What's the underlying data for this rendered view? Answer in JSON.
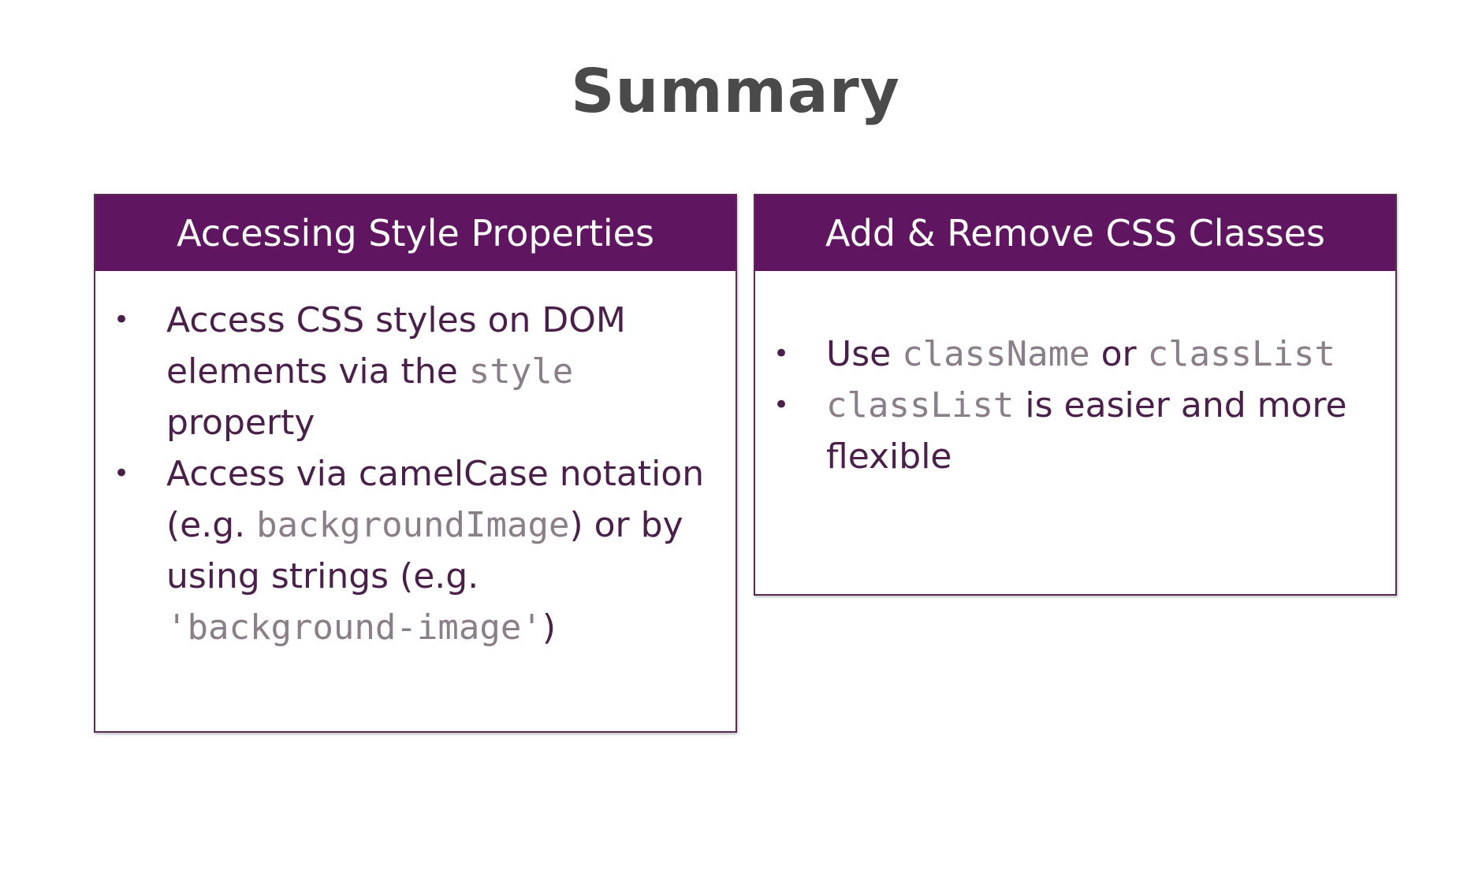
{
  "title": "Summary",
  "colors": {
    "header_bg": "#5f155f",
    "title": "#4a4a4a",
    "body_text": "#4a1f4a",
    "code_text": "#8a7f88"
  },
  "left_card": {
    "header": "Accessing Style Properties",
    "bullet_1": {
      "t1": "Access CSS styles on DOM elements via the ",
      "c1": "style",
      "t2": " property"
    },
    "bullet_2": {
      "t1": "Access via camelCase notation (e.g. ",
      "c1": "backgroundImage",
      "t2": ") or by using strings (e.g. ",
      "c2": "'background-image'",
      "t3": ")"
    }
  },
  "right_card": {
    "header": "Add & Remove CSS Classes",
    "bullet_1": {
      "t1": "Use ",
      "c1": "className",
      "t2": " or ",
      "c2": "classList"
    },
    "bullet_2": {
      "c1": "classList",
      "t1": " is easier and more flexible"
    }
  }
}
